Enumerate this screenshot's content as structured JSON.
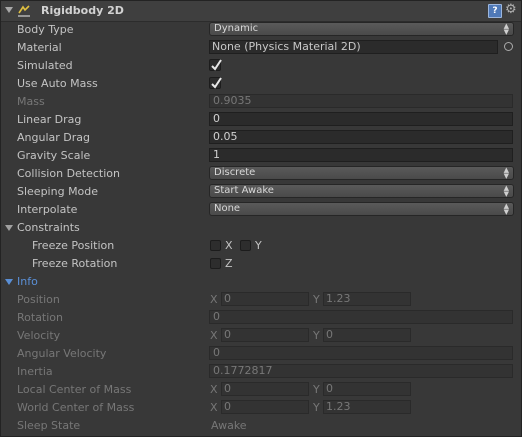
{
  "component": {
    "title": "Rigidbody 2D",
    "help_icon": "help-icon",
    "gear_icon": "gear-icon",
    "component_icon": "rigidbody2d-icon"
  },
  "props": {
    "body_type": {
      "label": "Body Type",
      "value": "Dynamic"
    },
    "material": {
      "label": "Material",
      "value": "None (Physics Material 2D)"
    },
    "simulated": {
      "label": "Simulated",
      "checked": true
    },
    "use_auto_mass": {
      "label": "Use Auto Mass",
      "checked": true
    },
    "mass": {
      "label": "Mass",
      "value": "0.9035"
    },
    "linear_drag": {
      "label": "Linear Drag",
      "value": "0"
    },
    "angular_drag": {
      "label": "Angular Drag",
      "value": "0.05"
    },
    "gravity_scale": {
      "label": "Gravity Scale",
      "value": "1"
    },
    "collision_detection": {
      "label": "Collision Detection",
      "value": "Discrete"
    },
    "sleeping_mode": {
      "label": "Sleeping Mode",
      "value": "Start Awake"
    },
    "interpolate": {
      "label": "Interpolate",
      "value": "None"
    }
  },
  "constraints": {
    "label": "Constraints",
    "freeze_position": {
      "label": "Freeze Position",
      "x": "X",
      "y": "Y"
    },
    "freeze_rotation": {
      "label": "Freeze Rotation",
      "z": "Z"
    }
  },
  "info": {
    "label": "Info",
    "position": {
      "label": "Position",
      "x_label": "X",
      "x": "0",
      "y_label": "Y",
      "y": "1.23"
    },
    "rotation": {
      "label": "Rotation",
      "value": "0"
    },
    "velocity": {
      "label": "Velocity",
      "x_label": "X",
      "x": "0",
      "y_label": "Y",
      "y": "0"
    },
    "angular_velocity": {
      "label": "Angular Velocity",
      "value": "0"
    },
    "inertia": {
      "label": "Inertia",
      "value": "0.1772817"
    },
    "local_center_of_mass": {
      "label": "Local Center of Mass",
      "x_label": "X",
      "x": "0",
      "y_label": "Y",
      "y": "0"
    },
    "world_center_of_mass": {
      "label": "World Center of Mass",
      "x_label": "X",
      "x": "0",
      "y_label": "Y",
      "y": "1.23"
    },
    "sleep_state": {
      "label": "Sleep State",
      "value": "Awake"
    }
  },
  "colors": {
    "background": "#383838",
    "field": "#2b2b2b",
    "accent": "#5a8fd6",
    "disabled_text": "#777777",
    "text": "#c4c4c4"
  }
}
